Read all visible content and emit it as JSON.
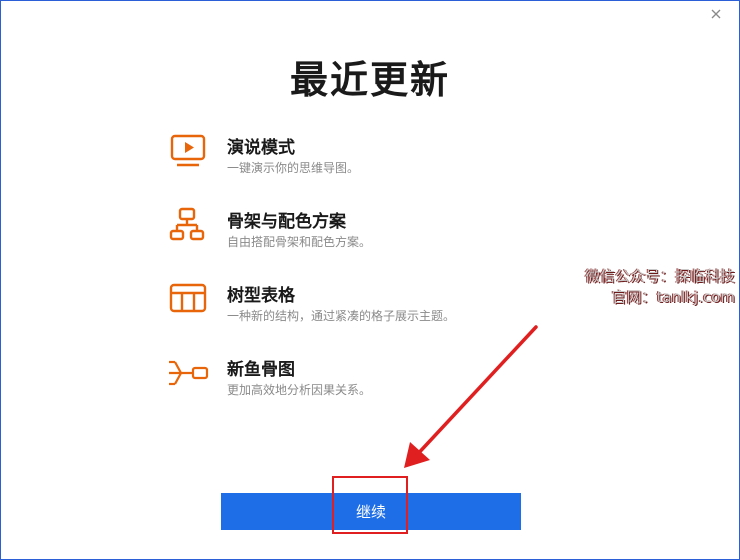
{
  "dialog": {
    "title": "最近更新",
    "close_icon": "close-icon"
  },
  "features": [
    {
      "icon": "presentation-icon",
      "title": "演说模式",
      "desc": "一键演示你的思维导图。"
    },
    {
      "icon": "skeleton-icon",
      "title": "骨架与配色方案",
      "desc": "自由搭配骨架和配色方案。"
    },
    {
      "icon": "table-icon",
      "title": "树型表格",
      "desc": "一种新的结构，通过紧凑的格子展示主题。"
    },
    {
      "icon": "fishbone-icon",
      "title": "新鱼骨图",
      "desc": "更加高效地分析因果关系。"
    }
  ],
  "watermark": {
    "line1": "微信公众号：探临科技",
    "line2": "官网：tanlkj.com"
  },
  "continue_button": {
    "label": "继续"
  },
  "colors": {
    "accent": "#e8650a",
    "button": "#1e6ee8",
    "annotation": "#e02020"
  }
}
